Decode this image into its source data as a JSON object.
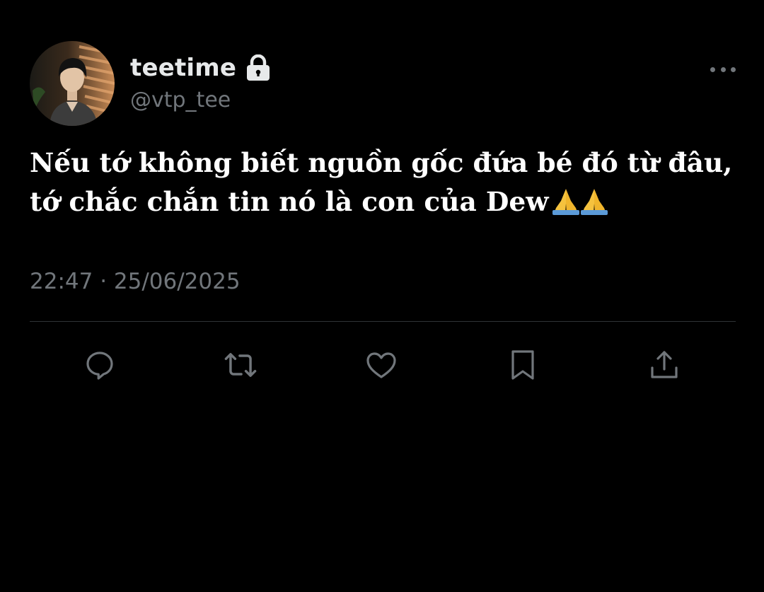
{
  "tweet": {
    "display_name": "teetime",
    "handle": "@vtp_tee",
    "protected_icon": "lock-icon",
    "text_lines": [
      "Nếu tớ không biết nguồn gốc đứa bé đó từ đâu,",
      "tớ chắc chắn tin nó là con của Dew"
    ],
    "emoji": "folded-hands-emoji ×2",
    "timestamp": "22:47 · 25/06/2025"
  },
  "actions": [
    {
      "name": "reply",
      "icon": "reply-icon"
    },
    {
      "name": "retweet",
      "icon": "retweet-icon"
    },
    {
      "name": "like",
      "icon": "heart-icon"
    },
    {
      "name": "bookmark",
      "icon": "bookmark-icon"
    },
    {
      "name": "share",
      "icon": "share-icon"
    }
  ],
  "colors": {
    "background": "#000000",
    "primary_text": "#e7e9ea",
    "secondary_text": "#71767b",
    "divider": "#2f3336"
  }
}
